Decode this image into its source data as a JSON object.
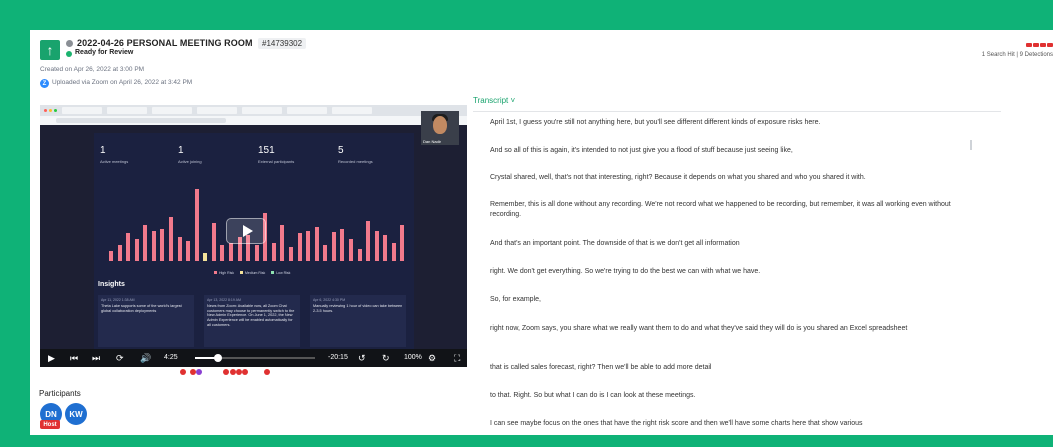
{
  "header": {
    "title": "2022-04-26 PERSONAL MEETING ROOM",
    "record_id": "#14739302",
    "status": "Ready for Review",
    "created": "Created on Apr 26, 2022 at 3:00 PM",
    "uploaded": "Uploaded via Zoom on April 26, 2022 at 3:42 PM",
    "zoom_icon_letter": "Z",
    "hits": "1 Search Hit | 9 Detections"
  },
  "video": {
    "camera_name": "Dan Nadir",
    "stats": [
      {
        "value": "1",
        "label": "Active meetings"
      },
      {
        "value": "1",
        "label": "Active joining"
      },
      {
        "value": "151",
        "label": "External participants"
      },
      {
        "value": "5",
        "label": "Recorded meetings"
      }
    ],
    "chart_values": [
      0.12,
      0.2,
      0.35,
      0.28,
      0.45,
      0.38,
      0.4,
      0.55,
      0.3,
      0.25,
      0.9,
      0.1,
      0.48,
      0.2,
      0.22,
      0.3,
      0.33,
      0.2,
      0.6,
      0.22,
      0.45,
      0.18,
      0.35,
      0.38,
      0.42,
      0.2,
      0.36,
      0.4,
      0.28,
      0.15,
      0.5,
      0.38,
      0.32,
      0.22,
      0.45
    ],
    "legend": [
      "High Risk",
      "Medium Risk",
      "Low Risk"
    ],
    "insights_title": "Insights",
    "insights": [
      {
        "date": "Apr 11, 2022 1:38 AM",
        "text": "Theta Lake supports some of the world's largest global collaboration deployments"
      },
      {
        "date": "Apr 13, 2022 8:19 AM",
        "text": "News from Zoom: Available now, all Zoom Chat customers may choose to permanently switch to the New Admin Experience. On June 1, 2022, the New Admin Experience will be enabled automatically for all customers."
      },
      {
        "date": "Apr 6, 2022 4:30 PM",
        "text": "Manually reviewing 1 hour of video can take between 2-3.5 hours."
      }
    ],
    "current_time": "4:25",
    "remaining_time": "-20:15",
    "speed": "100%"
  },
  "participants": {
    "label": "Participants",
    "people": [
      {
        "initials": "DN",
        "host": "Host"
      },
      {
        "initials": "KW"
      }
    ]
  },
  "transcript": {
    "label": "Transcript",
    "lines": [
      "April 1st, I guess you're still not anything here, but you'll see different different kinds of exposure risks here.",
      "And so all of this is again, it's intended to not just give you a flood of stuff because just seeing like,",
      "Crystal shared, well, that's not that interesting, right? Because it depends on what you shared and who you shared it with.",
      "Remember, this is all done without any recording. We're not record what we happened to be recording, but remember, it was all working even without recording.",
      "And that's an important point. The downside of that is we don't get all information",
      "right. We don't get everything. So we're trying to do the best we can with what we have.",
      "So, for example,",
      "right now, Zoom says, you share what we really want them to do and what they've said they will do is you shared an Excel spreadsheet",
      "that is called sales forecast, right? Then we'll be able to add more detail",
      "to that. Right. So but what I can do is I can look at these meetings.",
      "I can see maybe focus on the ones that have the right risk score and then we'll have some charts here that show various"
    ]
  },
  "colors": {
    "background": "#0fb277",
    "accent": "#19a36d",
    "risk_red": "#e03131",
    "avatar_blue": "#1f6fd1"
  }
}
